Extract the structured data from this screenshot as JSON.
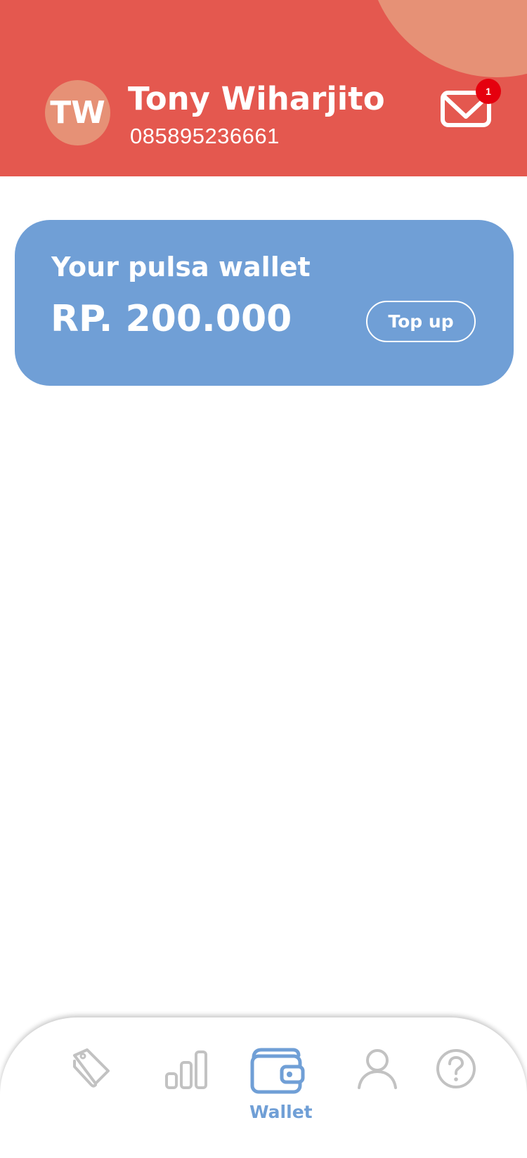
{
  "colors": {
    "header_bg": "#e4584f",
    "header_blob": "#e69176",
    "avatar_bg": "#e69176",
    "card_bg": "#709fd6",
    "badge_bg": "#e5000e",
    "nav_active": "#709fd6",
    "nav_inactive": "#c2c2c2"
  },
  "header": {
    "avatar_initials": "TW",
    "user_name": "Tony Wiharjito",
    "phone": "085895236661",
    "mail_icon": "envelope-icon",
    "unread_count": "1"
  },
  "wallet": {
    "title": "Your pulsa wallet",
    "amount": "RP. 200.000",
    "topup_label": "Top up"
  },
  "bottom_nav": {
    "items": [
      {
        "icon": "tags-icon",
        "label": "",
        "active": false
      },
      {
        "icon": "signal-bars-icon",
        "label": "",
        "active": false
      },
      {
        "icon": "wallet-icon",
        "label": "Wallet",
        "active": true
      },
      {
        "icon": "user-icon",
        "label": "",
        "active": false
      },
      {
        "icon": "help-icon",
        "label": "",
        "active": false
      }
    ]
  }
}
